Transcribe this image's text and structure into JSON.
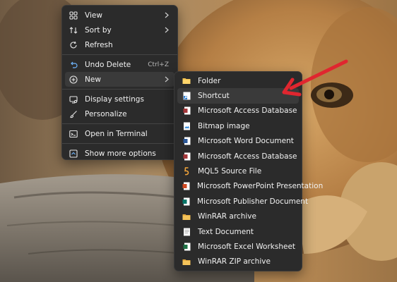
{
  "context_menu": {
    "items": [
      {
        "label": "View",
        "icon": "grid-icon"
      },
      {
        "label": "Sort by",
        "icon": "sort-icon"
      },
      {
        "label": "Refresh",
        "icon": "refresh-icon"
      },
      {
        "label": "Undo Delete",
        "shortcut": "Ctrl+Z",
        "icon": "undo-icon"
      },
      {
        "label": "New",
        "icon": "plus-circle-icon"
      },
      {
        "label": "Display settings",
        "icon": "display-icon"
      },
      {
        "label": "Personalize",
        "icon": "brush-icon"
      },
      {
        "label": "Open in Terminal",
        "icon": "terminal-icon"
      },
      {
        "label": "Show more options",
        "icon": "more-options-icon"
      }
    ]
  },
  "new_submenu": {
    "items": [
      {
        "label": "Folder",
        "icon": "folder-icon"
      },
      {
        "label": "Shortcut",
        "icon": "shortcut-icon"
      },
      {
        "label": "Microsoft Access Database",
        "icon": "access-file-icon"
      },
      {
        "label": "Bitmap image",
        "icon": "bitmap-file-icon"
      },
      {
        "label": "Microsoft Word Document",
        "icon": "word-file-icon"
      },
      {
        "label": "Microsoft Access Database",
        "icon": "access-file-icon"
      },
      {
        "label": "MQL5 Source File",
        "icon": "mql5-file-icon"
      },
      {
        "label": "Microsoft PowerPoint Presentation",
        "icon": "powerpoint-file-icon"
      },
      {
        "label": "Microsoft Publisher Document",
        "icon": "publisher-file-icon"
      },
      {
        "label": "WinRAR archive",
        "icon": "winrar-icon"
      },
      {
        "label": "Text Document",
        "icon": "text-file-icon"
      },
      {
        "label": "Microsoft Excel Worksheet",
        "icon": "excel-file-icon"
      },
      {
        "label": "WinRAR ZIP archive",
        "icon": "winrar-zip-icon"
      }
    ]
  },
  "colors": {
    "menu_bg": "#2b2b2b",
    "hover_bg": "#3a3a3a",
    "text": "#f2f2f2",
    "annotation_arrow": "#e0262f"
  }
}
